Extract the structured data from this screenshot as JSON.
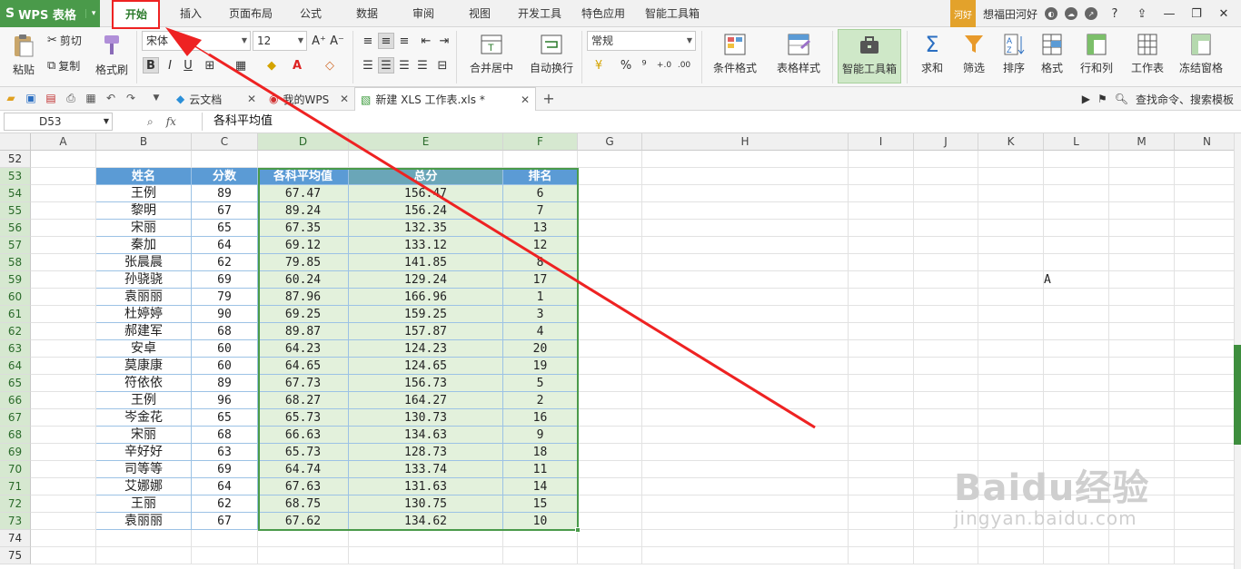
{
  "app": {
    "name": "WPS 表格",
    "logo_glyph": "S",
    "caret": "▾"
  },
  "menu_tabs": [
    "开始",
    "插入",
    "页面布局",
    "公式",
    "数据",
    "审阅",
    "视图",
    "开发工具",
    "特色应用",
    "智能工具箱"
  ],
  "active_menu_tab": "开始",
  "user": {
    "avatar_text": "河好",
    "name": "想福田河好"
  },
  "window_controls": {
    "help": "?",
    "minimize": "—",
    "restore": "❐",
    "close": "✕"
  },
  "ribbon": {
    "paste": "粘贴",
    "cut": "剪切",
    "copy": "复制",
    "format_painter": "格式刷",
    "font_name": "宋体",
    "font_size": "12",
    "bold": "B",
    "italic": "I",
    "underline": "U",
    "grow_font": "A⁺",
    "shrink_font": "A⁻",
    "merge_center": "合并居中",
    "wrap_text": "自动换行",
    "number_format": "常规",
    "percent": "%",
    "thousands": "⁹",
    "inc_decimal": "+.0",
    "dec_decimal": ".00",
    "conditional_format": "条件格式",
    "table_style": "表格样式",
    "smart_toolbox": "智能工具箱",
    "sum": "求和",
    "filter": "筛选",
    "sort": "排序",
    "format": "格式",
    "row_col": "行和列",
    "worksheet": "工作表",
    "freeze": "冻结窗格"
  },
  "doc_tabs": [
    {
      "label": "云文档",
      "close": "✕"
    },
    {
      "label": "我的WPS",
      "close": "✕"
    },
    {
      "label": "新建 XLS 工作表.xls *",
      "close": "✕"
    }
  ],
  "new_tab": "+",
  "search_command": "查找命令、搜索模板",
  "formula_bar": {
    "name_box": "D53",
    "fx": "fx",
    "content": "各科平均值"
  },
  "columns": [
    "A",
    "B",
    "C",
    "D",
    "E",
    "F",
    "G",
    "H",
    "I",
    "J",
    "K",
    "L",
    "M",
    "N"
  ],
  "row_numbers": [
    "52",
    "53",
    "54",
    "55",
    "56",
    "57",
    "58",
    "59",
    "60",
    "61",
    "62",
    "63",
    "64",
    "65",
    "66",
    "67",
    "68",
    "69",
    "70",
    "71",
    "72",
    "73",
    "74",
    "75"
  ],
  "table": {
    "headers": [
      "姓名",
      "分数",
      "各科平均值",
      "总分",
      "排名"
    ],
    "rows": [
      [
        "王例",
        "89",
        "67.47",
        "156.47",
        "6"
      ],
      [
        "黎明",
        "67",
        "89.24",
        "156.24",
        "7"
      ],
      [
        "宋丽",
        "65",
        "67.35",
        "132.35",
        "13"
      ],
      [
        "秦加",
        "64",
        "69.12",
        "133.12",
        "12"
      ],
      [
        "张晨晨",
        "62",
        "79.85",
        "141.85",
        "8"
      ],
      [
        "孙骁骁",
        "69",
        "60.24",
        "129.24",
        "17"
      ],
      [
        "袁丽丽",
        "79",
        "87.96",
        "166.96",
        "1"
      ],
      [
        "杜婷婷",
        "90",
        "69.25",
        "159.25",
        "3"
      ],
      [
        "郝建军",
        "68",
        "89.87",
        "157.87",
        "4"
      ],
      [
        "安卓",
        "60",
        "64.23",
        "124.23",
        "20"
      ],
      [
        "莫康康",
        "60",
        "64.65",
        "124.65",
        "19"
      ],
      [
        "符依依",
        "89",
        "67.73",
        "156.73",
        "5"
      ],
      [
        "王例",
        "96",
        "68.27",
        "164.27",
        "2"
      ],
      [
        "岑金花",
        "65",
        "65.73",
        "130.73",
        "16"
      ],
      [
        "宋丽",
        "68",
        "66.63",
        "134.63",
        "9"
      ],
      [
        "辛好好",
        "63",
        "65.73",
        "128.73",
        "18"
      ],
      [
        "司等等",
        "69",
        "64.74",
        "133.74",
        "11"
      ],
      [
        "艾娜娜",
        "64",
        "67.63",
        "131.63",
        "14"
      ],
      [
        "王丽",
        "62",
        "68.75",
        "130.75",
        "15"
      ],
      [
        "袁丽丽",
        "67",
        "67.62",
        "134.62",
        "10"
      ]
    ]
  },
  "stray_cell": {
    "ref": "L59",
    "value": "A"
  },
  "colors": {
    "accent": "#4a9a4a",
    "header_blue": "#5b9bd5",
    "header_teal": "#6aa6b8",
    "annotation_red": "#ee2222"
  },
  "watermark": {
    "line1": "Baidu经验",
    "line2": "jingyan.baidu.com"
  }
}
